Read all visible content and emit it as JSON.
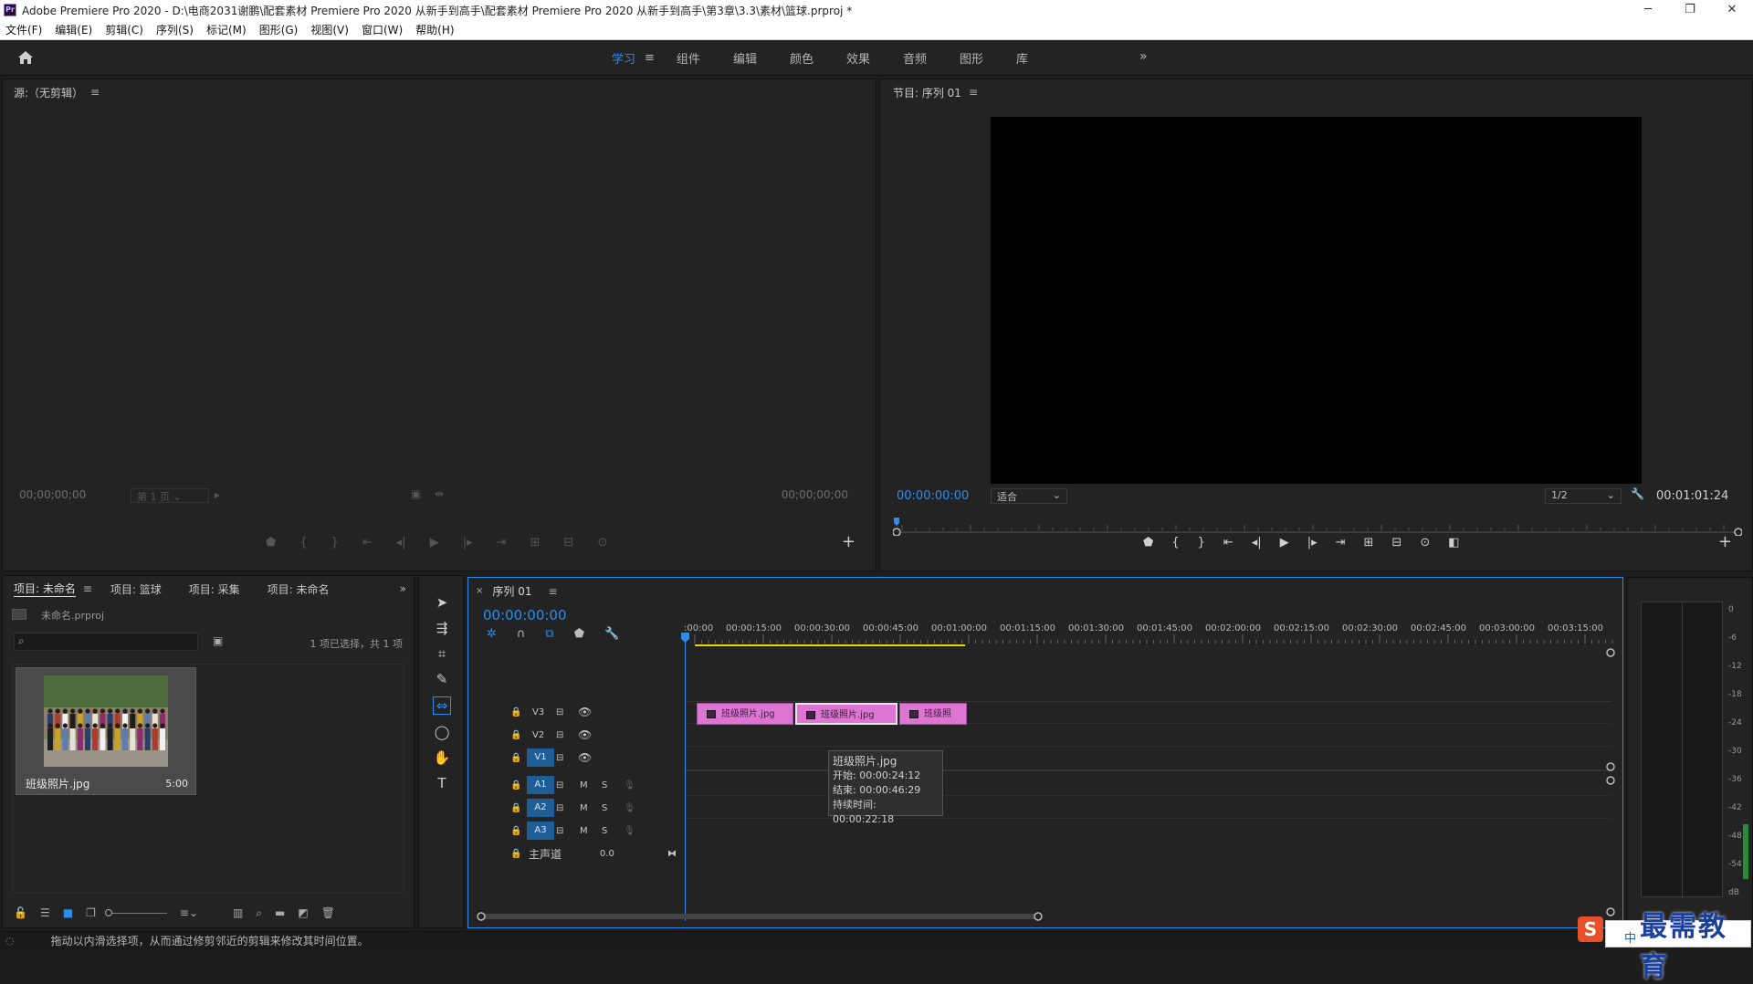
{
  "window": {
    "title": "Adobe Premiere Pro 2020 - D:\\电商2031谢鹏\\配套素材 Premiere Pro 2020 从新手到高手\\配套素材 Premiere Pro 2020 从新手到高手\\第3章\\3.3\\素材\\篮球.prproj *",
    "app_icon": "Pr",
    "minimize": "─",
    "maximize": "❐",
    "close": "✕"
  },
  "menu": [
    "文件(F)",
    "编辑(E)",
    "剪辑(C)",
    "序列(S)",
    "标记(M)",
    "图形(G)",
    "视图(V)",
    "窗口(W)",
    "帮助(H)"
  ],
  "workspaces": {
    "tabs": [
      "学习",
      "组件",
      "编辑",
      "颜色",
      "效果",
      "音频",
      "图形",
      "库"
    ],
    "active": "学习",
    "more": "»"
  },
  "source_monitor": {
    "title": "源:（无剪辑）",
    "timecode_left": "00;00;00;00",
    "page": "第 1 页",
    "timecode_right": "00;00;00;00"
  },
  "program_monitor": {
    "title": "节目: 序列 01",
    "timecode": "00:00:00:00",
    "fit": "适合",
    "resolution": "1/2",
    "duration": "00:01:01:24"
  },
  "project_panel": {
    "tabs": [
      "项目: 未命名",
      "项目: 篮球",
      "项目: 采集",
      "项目: 未命名"
    ],
    "file": "未命名.prproj",
    "selection_info": "1 项已选择，共 1 项",
    "item": {
      "name": "班级照片.jpg",
      "duration": "5:00"
    }
  },
  "timeline": {
    "tab": "序列 01",
    "timecode": "00:00:00:00",
    "ruler": [
      ":00:00",
      "00:00:15:00",
      "00:00:30:00",
      "00:00:45:00",
      "00:01:00:00",
      "00:01:15:00",
      "00:01:30:00",
      "00:01:45:00",
      "00:02:00:00",
      "00:02:15:00",
      "00:02:30:00",
      "00:02:45:00",
      "00:03:00:00",
      "00:03:15:00"
    ],
    "video_tracks": [
      "V3",
      "V2",
      "V1"
    ],
    "audio_tracks": [
      "A1",
      "A2",
      "A3"
    ],
    "audio_buttons": {
      "mute": "M",
      "solo": "S"
    },
    "master": {
      "label": "主声道",
      "value": "0.0"
    },
    "clips": [
      "班级照片.jpg",
      "班级照片.jpg",
      "班级照"
    ],
    "tooltip": {
      "name": "班级照片.jpg",
      "start": "开始: 00:00:24:12",
      "end": "结束: 00:00:46:29",
      "duration": "持续时间: 00:00:22:18"
    }
  },
  "audio_meter": {
    "labels": [
      "0",
      "-6",
      "-12",
      "-18",
      "-24",
      "-30",
      "-36",
      "-42",
      "-48",
      "-54",
      "dB"
    ]
  },
  "status_bar": {
    "text": "拖动以内滑选择项，从而通过修剪邻近的剪辑来修改其时间位置。"
  },
  "watermark": {
    "text": "最需教育",
    "ime": "中"
  },
  "colors": {
    "accent_blue": "#2d8ceb",
    "clip_pink": "#dd76d3",
    "track_blue": "#1e5d96",
    "work_area_yellow": "#e8d800"
  }
}
